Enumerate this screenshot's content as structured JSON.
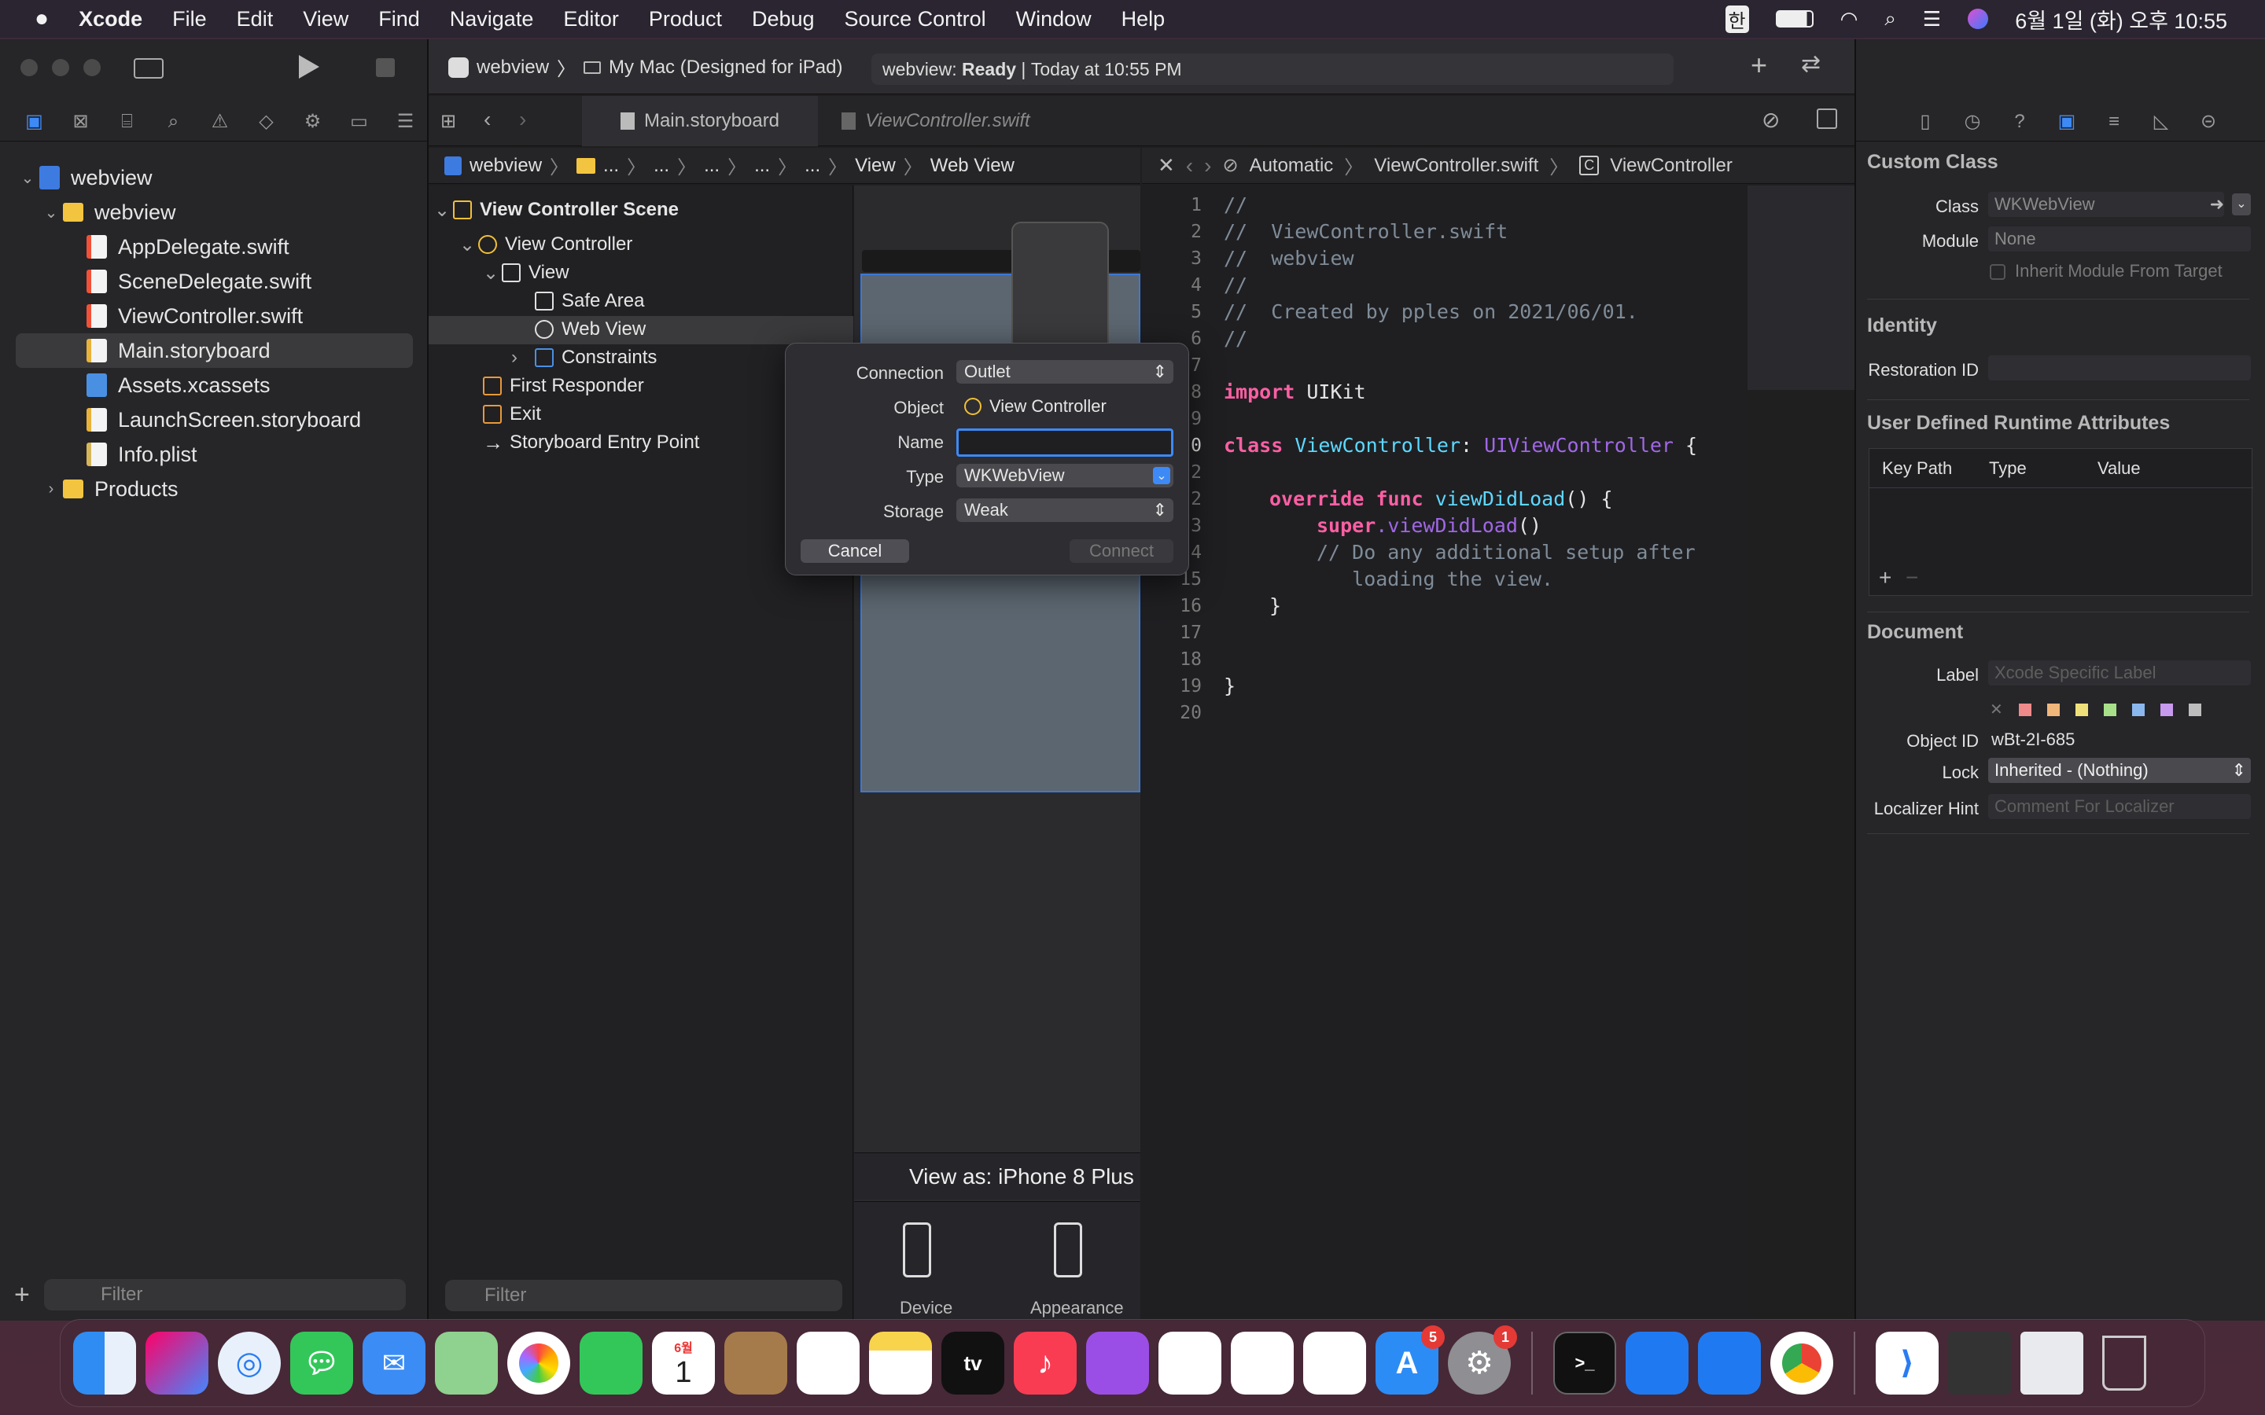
{
  "menubar": {
    "apple": "",
    "app": "Xcode",
    "items": [
      "File",
      "Edit",
      "View",
      "Find",
      "Navigate",
      "Editor",
      "Product",
      "Debug",
      "Source Control",
      "Window",
      "Help"
    ],
    "input_method": "한",
    "datetime": "6월 1일 (화) 오후 10:55"
  },
  "toolbar": {
    "scheme": "webview",
    "destination": "My Mac (Designed for iPad)",
    "activity_prefix": "webview:",
    "activity_status": "Ready",
    "activity_time": "Today at 10:55 PM"
  },
  "tabs": {
    "main": "Main.storyboard",
    "vc": "ViewController.swift"
  },
  "navigator": {
    "project": "webview",
    "group": "webview",
    "files": [
      "AppDelegate.swift",
      "SceneDelegate.swift",
      "ViewController.swift",
      "Main.storyboard",
      "Assets.xcassets",
      "LaunchScreen.storyboard",
      "Info.plist"
    ],
    "products": "Products",
    "filter_placeholder": "Filter"
  },
  "jump_left": {
    "project": "webview",
    "ellipsis": "...",
    "view": "View",
    "webview": "Web View"
  },
  "jump_right": {
    "mode": "Automatic",
    "file": "ViewController.swift",
    "symbol": "ViewController"
  },
  "outline": {
    "scene": "View Controller Scene",
    "vc": "View Controller",
    "view": "View",
    "safe_area": "Safe Area",
    "web_view": "Web View",
    "constraints": "Constraints",
    "first_responder": "First Responder",
    "exit": "Exit",
    "entry": "Storyboard Entry Point",
    "filter_placeholder": "Filter"
  },
  "canvas": {
    "view_as": "View as: iPhone 8 Plus (",
    "device": "Device",
    "appearance": "Appearance"
  },
  "code": {
    "line_numbers": [
      "1",
      "2",
      "3",
      "4",
      "5",
      "6",
      "7",
      "8",
      "9",
      "0",
      "2",
      "2",
      "3",
      "4",
      "15",
      "16",
      "17",
      "18",
      "19",
      "20"
    ],
    "l1": "//",
    "l2": "//  ViewController.swift",
    "l3": "//  webview",
    "l4": "//",
    "l5": "//  Created by pples on 2021/06/01.",
    "l6": "//",
    "import_kw": "import",
    "import_mod": " UIKit",
    "class_kw": "class",
    "class_name": " ViewController",
    "class_colon": ": ",
    "class_super": "UIViewController",
    "class_brace": " {",
    "override_kw": "override func",
    "fn_name": " viewDidLoad",
    "fn_rest": "() {",
    "super_kw": "super",
    "super_call": ".viewDidLoad",
    "super_rest": "()",
    "comment1": "// Do any additional setup after",
    "comment2": "   loading the view.",
    "close_inner": "}",
    "close_outer": "}"
  },
  "popover": {
    "connection_label": "Connection",
    "connection_value": "Outlet",
    "object_label": "Object",
    "object_value": "View Controller",
    "name_label": "Name",
    "name_value": "",
    "type_label": "Type",
    "type_value": "WKWebView",
    "storage_label": "Storage",
    "storage_value": "Weak",
    "cancel": "Cancel",
    "connect": "Connect"
  },
  "inspector": {
    "custom_class": "Custom Class",
    "class_label": "Class",
    "class_value": "WKWebView",
    "module_label": "Module",
    "module_value": "None",
    "inherit": "Inherit Module From Target",
    "identity": "Identity",
    "restoration_label": "Restoration ID",
    "udra": "User Defined Runtime Attributes",
    "col_keypath": "Key Path",
    "col_type": "Type",
    "col_value": "Value",
    "document": "Document",
    "label_label": "Label",
    "label_placeholder": "Xcode Specific Label",
    "objectid_label": "Object ID",
    "objectid_value": "wBt-2I-685",
    "lock_label": "Lock",
    "lock_value": "Inherited - (Nothing)",
    "localizer_label": "Localizer Hint",
    "localizer_placeholder": "Comment For Localizer"
  },
  "dock": {
    "calendar_month": "6월",
    "calendar_day": "1",
    "appstore_badge": "5",
    "settings_badge": "1",
    "tv": "tv"
  },
  "colors": {
    "accent": "#3d8af7",
    "keyword": "#fc5fa3",
    "type": "#5dd8ff",
    "function": "#a167e6"
  }
}
